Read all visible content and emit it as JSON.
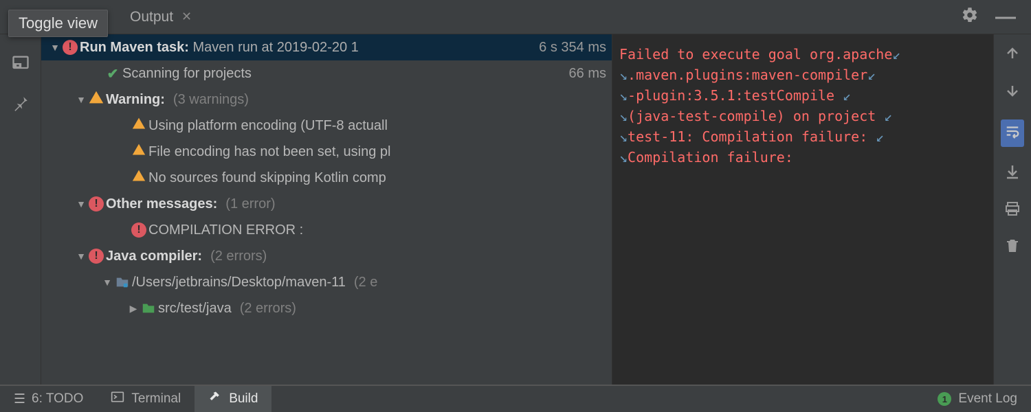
{
  "tooltip": "Toggle view",
  "tab": {
    "label": "Output"
  },
  "tree": {
    "root": {
      "title_bold": "Run Maven task:",
      "title_rest": " Maven run at 2019-02-20 1",
      "time": "6 s 354 ms"
    },
    "scan": {
      "label": "Scanning for projects",
      "time": "66 ms"
    },
    "warn": {
      "label": "Warning:",
      "count": "(3 warnings)",
      "items": [
        "Using platform encoding (UTF-8 actuall",
        "File encoding has not been set, using pl",
        "No sources found skipping Kotlin comp"
      ]
    },
    "other": {
      "label": "Other messages:",
      "count": "(1 error)",
      "items": [
        "COMPILATION ERROR :"
      ]
    },
    "java": {
      "label": "Java compiler:",
      "count": "(2 errors)",
      "path": {
        "label": "/Users/jetbrains/Desktop/maven-11",
        "count": "(2 e"
      },
      "sub": {
        "label": "src/test/java",
        "count": "(2 errors)"
      }
    }
  },
  "console": {
    "l1a": "Failed to execute goal org.apache",
    "l2a": ".maven.plugins:maven-compiler",
    "l3a": "-plugin:3.5.1:testCompile ",
    "l4a": "(java-test-compile) on project ",
    "l5a": "test-11: Compilation failure: ",
    "l6a": "Compilation failure:"
  },
  "status": {
    "todo": "6: TODO",
    "terminal": "Terminal",
    "build": "Build",
    "event": "Event Log",
    "event_badge": "1"
  }
}
